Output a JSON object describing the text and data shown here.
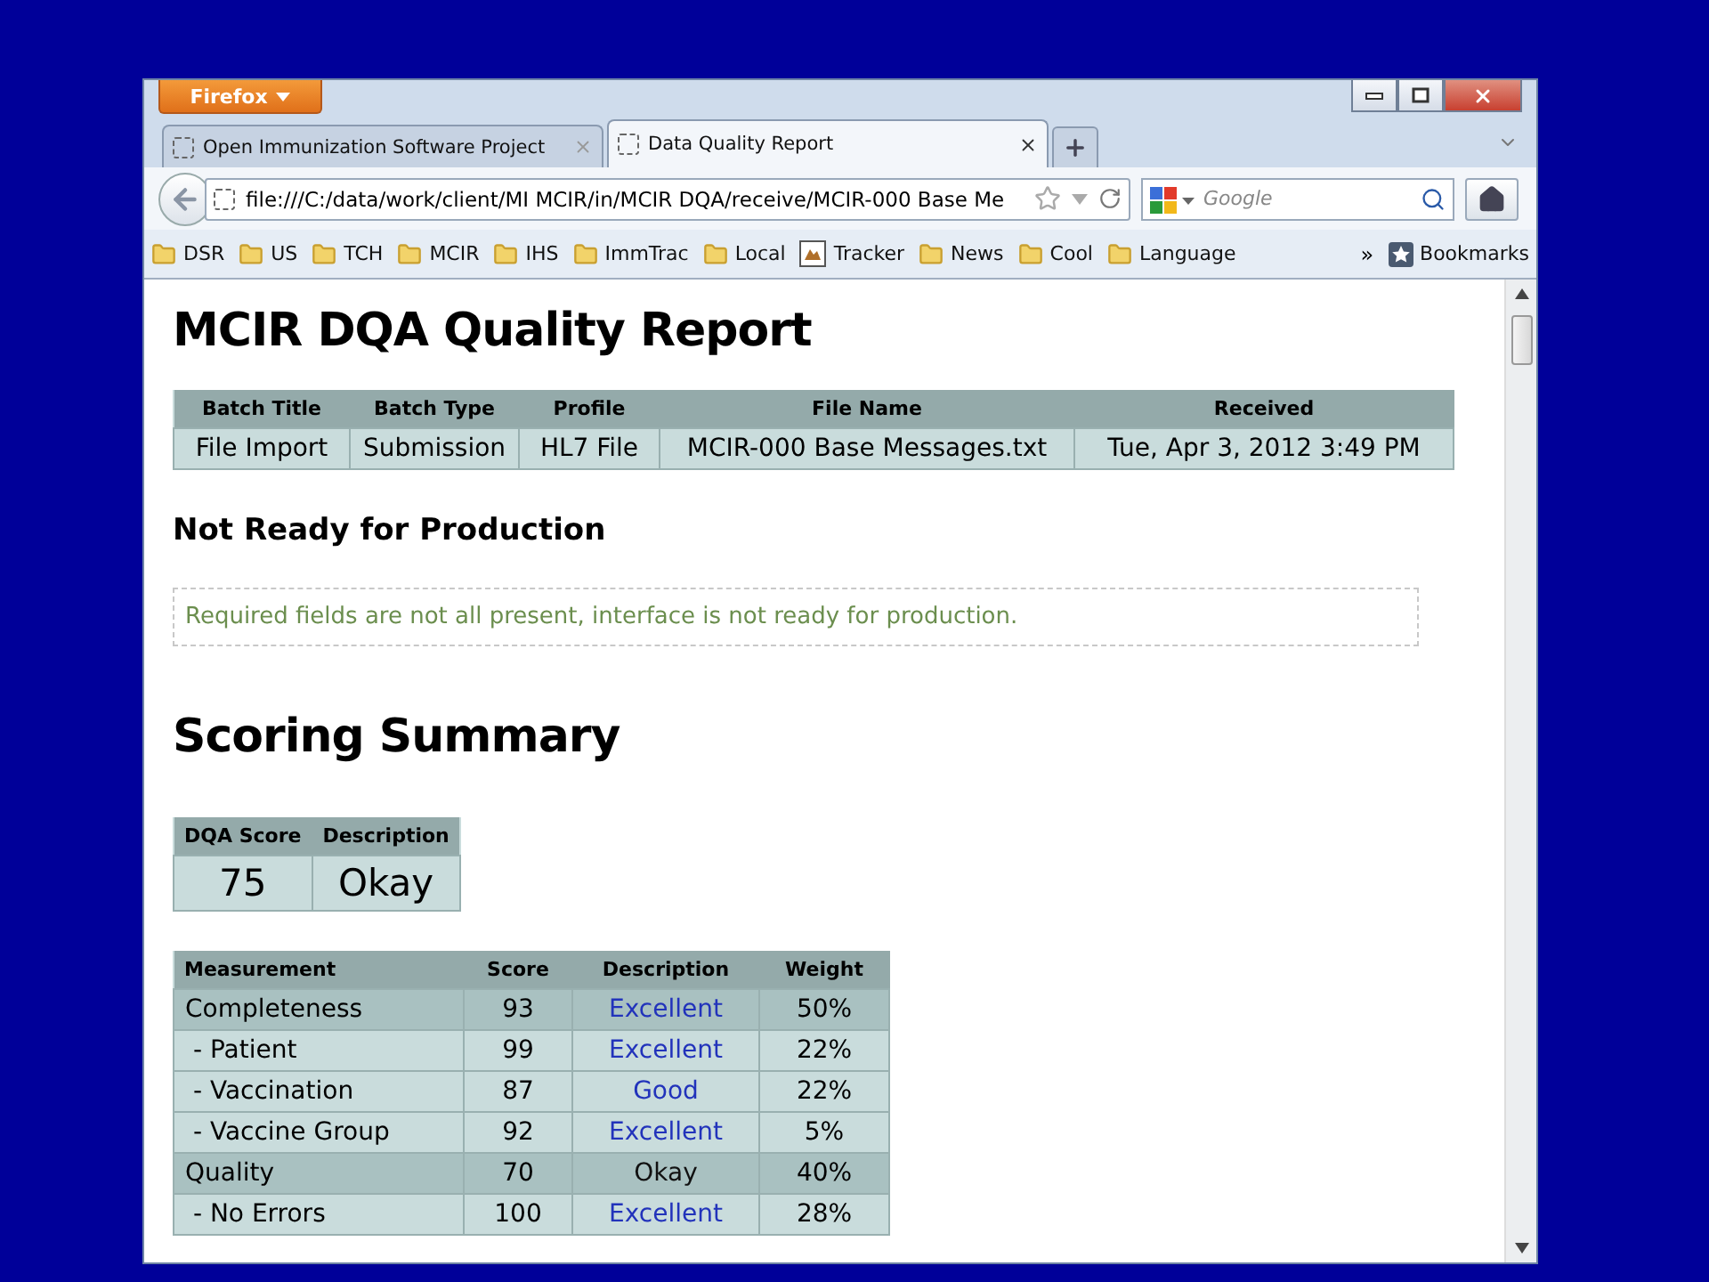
{
  "browser": {
    "app_button": "Firefox",
    "tabs": [
      {
        "title": "Open Immunization Software Project",
        "selected": false
      },
      {
        "title": "Data Quality Report",
        "selected": true
      }
    ],
    "url": "file:///C:/data/work/client/MI MCIR/in/MCIR DQA/receive/MCIR-000 Base Me",
    "search": {
      "placeholder": "Google"
    },
    "bookmarks": [
      {
        "label": "DSR",
        "kind": "folder"
      },
      {
        "label": "US",
        "kind": "folder"
      },
      {
        "label": "TCH",
        "kind": "folder"
      },
      {
        "label": "MCIR",
        "kind": "folder"
      },
      {
        "label": "IHS",
        "kind": "folder"
      },
      {
        "label": "ImmTrac",
        "kind": "folder"
      },
      {
        "label": "Local",
        "kind": "folder"
      },
      {
        "label": "Tracker",
        "kind": "image"
      },
      {
        "label": "News",
        "kind": "folder"
      },
      {
        "label": "Cool",
        "kind": "folder"
      },
      {
        "label": "Language",
        "kind": "folder"
      }
    ],
    "overflow": "»",
    "bookmarks_menu": "Bookmarks"
  },
  "page": {
    "title": "MCIR DQA Quality Report",
    "batch_table": {
      "columns": [
        "Batch Title",
        "Batch Type",
        "Profile",
        "File Name",
        "Received"
      ],
      "rows": [
        [
          "File Import",
          "Submission",
          "HL7 File",
          "MCIR-000 Base Messages.txt",
          "Tue, Apr 3, 2012 3:49 PM"
        ]
      ]
    },
    "status_heading": "Not Ready for Production",
    "status_message": "Required fields are not all present, interface is not ready for production.",
    "scoring_title": "Scoring Summary",
    "score_table": {
      "columns": [
        "DQA Score",
        "Description"
      ],
      "rows": [
        [
          "75",
          "Okay"
        ]
      ]
    },
    "measurement_table": {
      "columns": [
        "Measurement",
        "Score",
        "Description",
        "Weight"
      ],
      "rows": [
        {
          "kind": "group",
          "measurement": "Completeness",
          "score": "93",
          "description": "Excellent",
          "link": true,
          "weight": "50%"
        },
        {
          "kind": "sub",
          "measurement": " - Patient",
          "score": "99",
          "description": "Excellent",
          "link": true,
          "weight": "22%"
        },
        {
          "kind": "sub",
          "measurement": " - Vaccination",
          "score": "87",
          "description": "Good",
          "link": true,
          "weight": "22%"
        },
        {
          "kind": "sub",
          "measurement": " - Vaccine Group",
          "score": "92",
          "description": "Excellent",
          "link": true,
          "weight": "5%"
        },
        {
          "kind": "group",
          "measurement": "Quality",
          "score": "70",
          "description": "Okay",
          "link": false,
          "weight": "40%"
        },
        {
          "kind": "sub",
          "measurement": " - No Errors",
          "score": "100",
          "description": "Excellent",
          "link": true,
          "weight": "28%"
        }
      ]
    }
  }
}
